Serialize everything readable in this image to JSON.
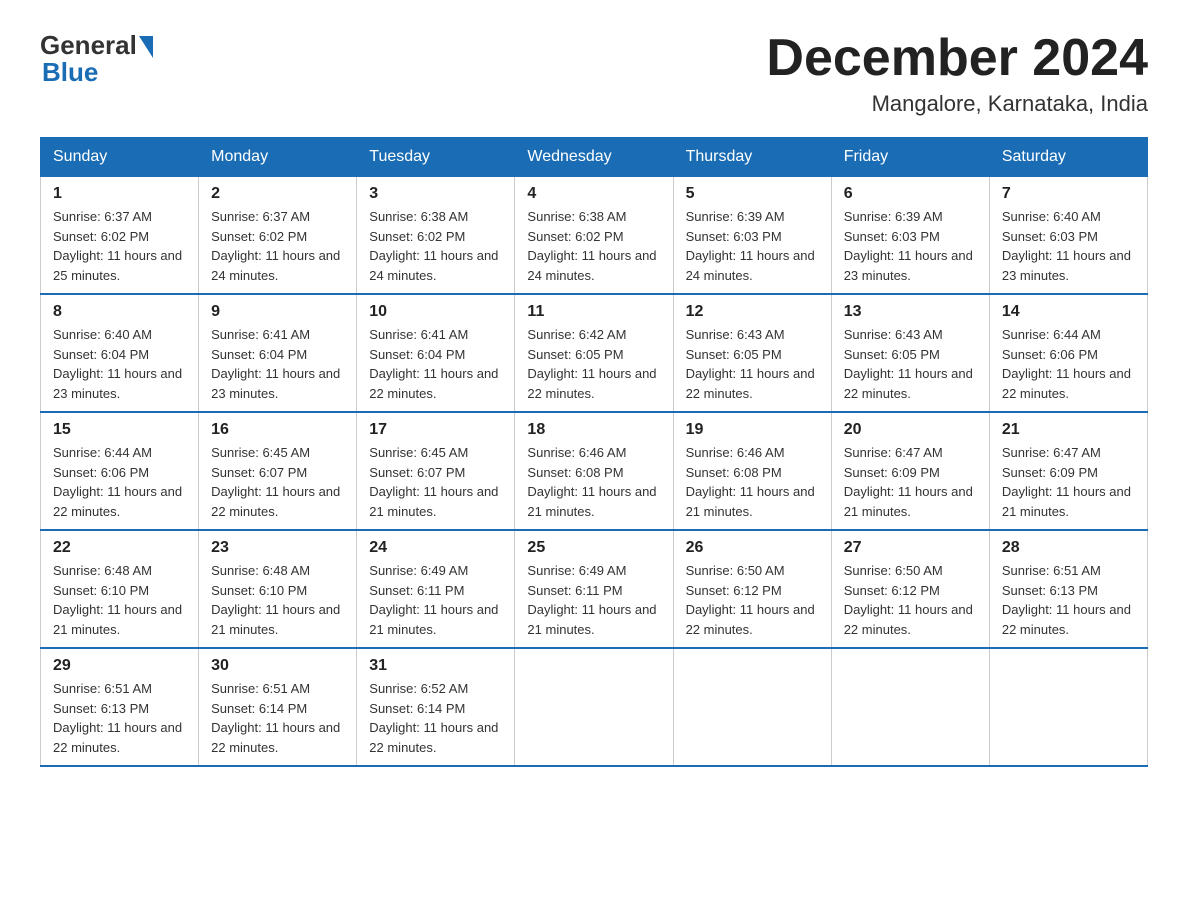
{
  "logo": {
    "general": "General",
    "blue": "Blue"
  },
  "title": "December 2024",
  "location": "Mangalore, Karnataka, India",
  "days_of_week": [
    "Sunday",
    "Monday",
    "Tuesday",
    "Wednesday",
    "Thursday",
    "Friday",
    "Saturday"
  ],
  "weeks": [
    [
      {
        "day": "1",
        "sunrise": "6:37 AM",
        "sunset": "6:02 PM",
        "daylight": "11 hours and 25 minutes."
      },
      {
        "day": "2",
        "sunrise": "6:37 AM",
        "sunset": "6:02 PM",
        "daylight": "11 hours and 24 minutes."
      },
      {
        "day": "3",
        "sunrise": "6:38 AM",
        "sunset": "6:02 PM",
        "daylight": "11 hours and 24 minutes."
      },
      {
        "day": "4",
        "sunrise": "6:38 AM",
        "sunset": "6:02 PM",
        "daylight": "11 hours and 24 minutes."
      },
      {
        "day": "5",
        "sunrise": "6:39 AM",
        "sunset": "6:03 PM",
        "daylight": "11 hours and 24 minutes."
      },
      {
        "day": "6",
        "sunrise": "6:39 AM",
        "sunset": "6:03 PM",
        "daylight": "11 hours and 23 minutes."
      },
      {
        "day": "7",
        "sunrise": "6:40 AM",
        "sunset": "6:03 PM",
        "daylight": "11 hours and 23 minutes."
      }
    ],
    [
      {
        "day": "8",
        "sunrise": "6:40 AM",
        "sunset": "6:04 PM",
        "daylight": "11 hours and 23 minutes."
      },
      {
        "day": "9",
        "sunrise": "6:41 AM",
        "sunset": "6:04 PM",
        "daylight": "11 hours and 23 minutes."
      },
      {
        "day": "10",
        "sunrise": "6:41 AM",
        "sunset": "6:04 PM",
        "daylight": "11 hours and 22 minutes."
      },
      {
        "day": "11",
        "sunrise": "6:42 AM",
        "sunset": "6:05 PM",
        "daylight": "11 hours and 22 minutes."
      },
      {
        "day": "12",
        "sunrise": "6:43 AM",
        "sunset": "6:05 PM",
        "daylight": "11 hours and 22 minutes."
      },
      {
        "day": "13",
        "sunrise": "6:43 AM",
        "sunset": "6:05 PM",
        "daylight": "11 hours and 22 minutes."
      },
      {
        "day": "14",
        "sunrise": "6:44 AM",
        "sunset": "6:06 PM",
        "daylight": "11 hours and 22 minutes."
      }
    ],
    [
      {
        "day": "15",
        "sunrise": "6:44 AM",
        "sunset": "6:06 PM",
        "daylight": "11 hours and 22 minutes."
      },
      {
        "day": "16",
        "sunrise": "6:45 AM",
        "sunset": "6:07 PM",
        "daylight": "11 hours and 22 minutes."
      },
      {
        "day": "17",
        "sunrise": "6:45 AM",
        "sunset": "6:07 PM",
        "daylight": "11 hours and 21 minutes."
      },
      {
        "day": "18",
        "sunrise": "6:46 AM",
        "sunset": "6:08 PM",
        "daylight": "11 hours and 21 minutes."
      },
      {
        "day": "19",
        "sunrise": "6:46 AM",
        "sunset": "6:08 PM",
        "daylight": "11 hours and 21 minutes."
      },
      {
        "day": "20",
        "sunrise": "6:47 AM",
        "sunset": "6:09 PM",
        "daylight": "11 hours and 21 minutes."
      },
      {
        "day": "21",
        "sunrise": "6:47 AM",
        "sunset": "6:09 PM",
        "daylight": "11 hours and 21 minutes."
      }
    ],
    [
      {
        "day": "22",
        "sunrise": "6:48 AM",
        "sunset": "6:10 PM",
        "daylight": "11 hours and 21 minutes."
      },
      {
        "day": "23",
        "sunrise": "6:48 AM",
        "sunset": "6:10 PM",
        "daylight": "11 hours and 21 minutes."
      },
      {
        "day": "24",
        "sunrise": "6:49 AM",
        "sunset": "6:11 PM",
        "daylight": "11 hours and 21 minutes."
      },
      {
        "day": "25",
        "sunrise": "6:49 AM",
        "sunset": "6:11 PM",
        "daylight": "11 hours and 21 minutes."
      },
      {
        "day": "26",
        "sunrise": "6:50 AM",
        "sunset": "6:12 PM",
        "daylight": "11 hours and 22 minutes."
      },
      {
        "day": "27",
        "sunrise": "6:50 AM",
        "sunset": "6:12 PM",
        "daylight": "11 hours and 22 minutes."
      },
      {
        "day": "28",
        "sunrise": "6:51 AM",
        "sunset": "6:13 PM",
        "daylight": "11 hours and 22 minutes."
      }
    ],
    [
      {
        "day": "29",
        "sunrise": "6:51 AM",
        "sunset": "6:13 PM",
        "daylight": "11 hours and 22 minutes."
      },
      {
        "day": "30",
        "sunrise": "6:51 AM",
        "sunset": "6:14 PM",
        "daylight": "11 hours and 22 minutes."
      },
      {
        "day": "31",
        "sunrise": "6:52 AM",
        "sunset": "6:14 PM",
        "daylight": "11 hours and 22 minutes."
      },
      null,
      null,
      null,
      null
    ]
  ]
}
